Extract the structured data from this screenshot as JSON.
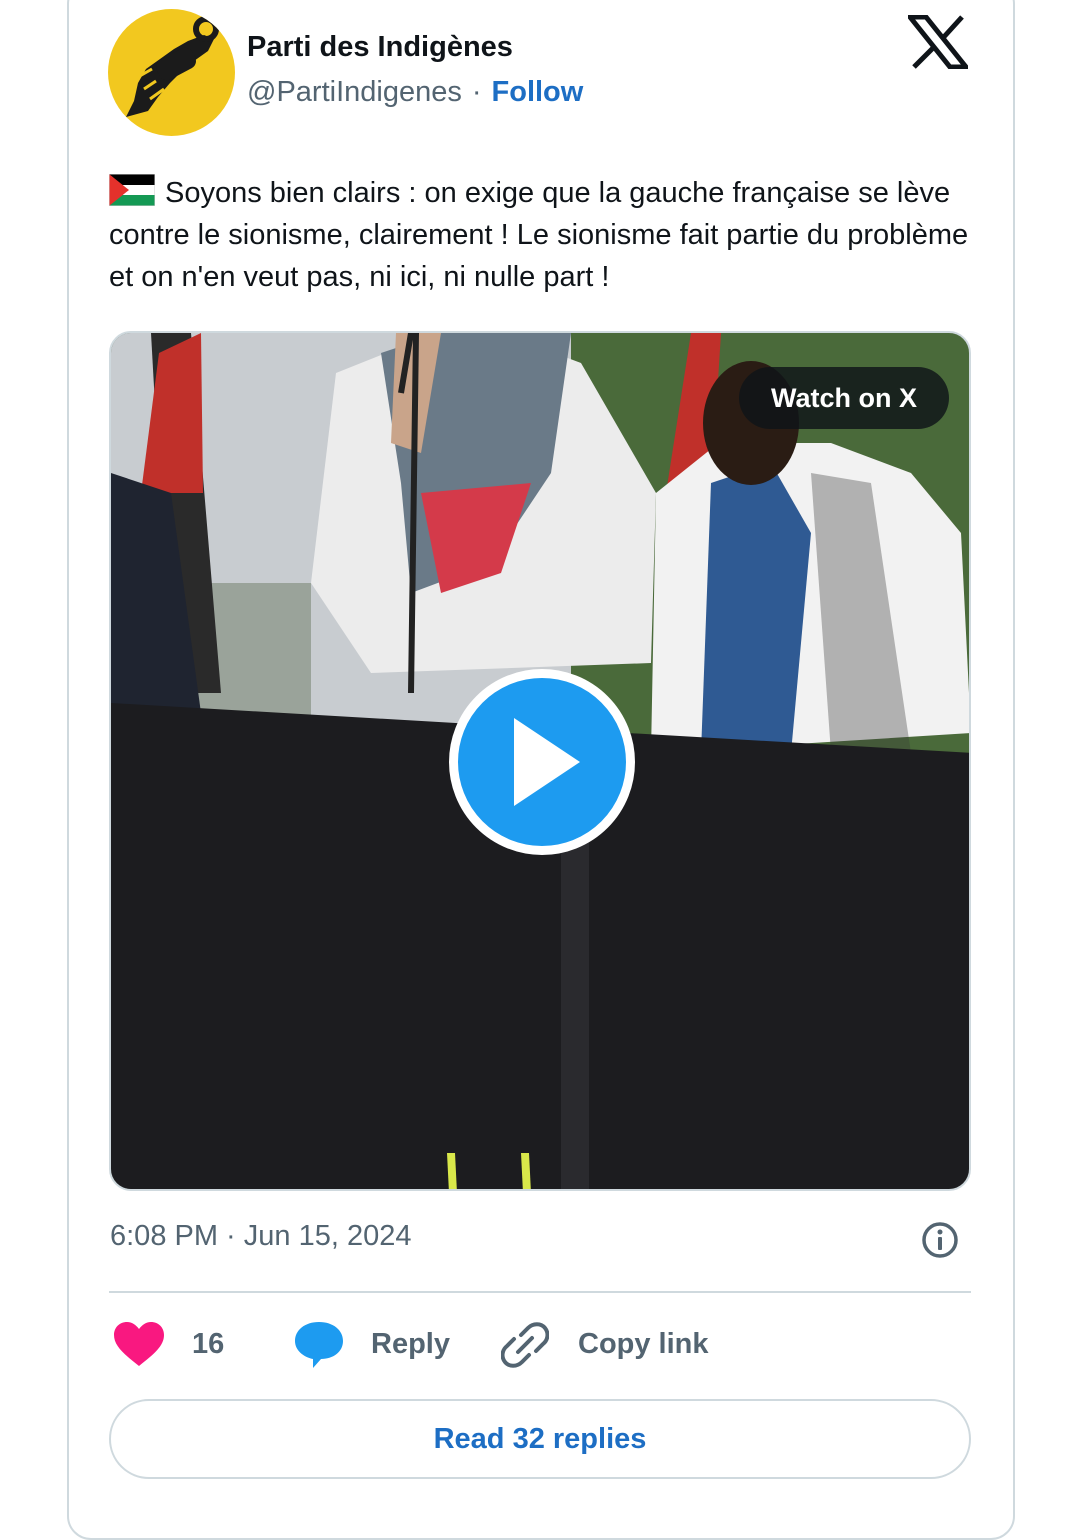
{
  "author": {
    "name": "Parti des Indigènes",
    "handle": "@PartiIndigenes",
    "separator": "·",
    "follow_label": "Follow"
  },
  "tweet": {
    "text": "Soyons bien clairs : on exige que la gauche française se lève contre le sionisme, clairement ! Le sionisme fait partie du problème et on n'en veut pas, ni ici, ni nulle part !",
    "flag_icon": "palestine-flag-emoji",
    "timestamp": "6:08 PM · Jun 15, 2024"
  },
  "media": {
    "watch_label": "Watch on X"
  },
  "actions": {
    "like_count": "16",
    "reply_label": "Reply",
    "copy_link_label": "Copy link"
  },
  "footer": {
    "read_replies_label": "Read 32 replies"
  },
  "colors": {
    "accent": "#1d9bf0",
    "link": "#1d6ec4",
    "like": "#f91880",
    "border": "#cfd9de",
    "muted": "#536471",
    "avatar_bg": "#f2c81f"
  }
}
